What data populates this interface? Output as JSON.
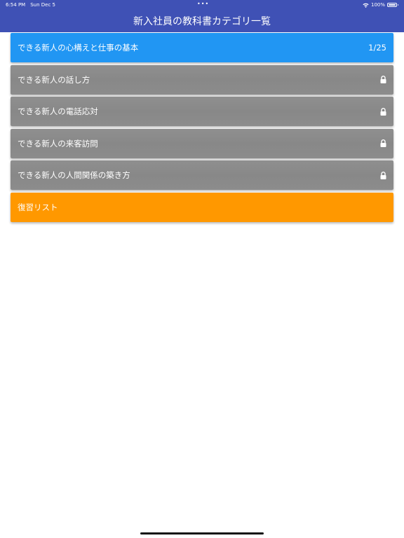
{
  "status_bar": {
    "time": "6:54 PM",
    "date": "Sun Dec 5",
    "dots": "•••",
    "battery": "100%",
    "wifi_icon": "wifi-icon",
    "battery_icon": "battery-icon"
  },
  "header": {
    "title": "新入社員の教科書カテゴリ一覧",
    "background": "#3f51b5"
  },
  "categories": [
    {
      "label": "できる新人の心構えと仕事の基本",
      "progress": "1/25",
      "state": "unlocked",
      "color": "#2196f3"
    },
    {
      "label": "できる新人の話し方",
      "state": "locked",
      "icon": "lock-icon",
      "color": "#8b8b8b"
    },
    {
      "label": "できる新人の電話応対",
      "state": "locked",
      "icon": "lock-icon",
      "color": "#8b8b8b"
    },
    {
      "label": "できる新人の来客訪問",
      "state": "locked",
      "icon": "lock-icon",
      "color": "#8b8b8b"
    },
    {
      "label": "できる新人の人間関係の築き方",
      "state": "locked",
      "icon": "lock-icon",
      "color": "#8b8b8b"
    }
  ],
  "review": {
    "label": "復習リスト",
    "color": "#ff9800"
  }
}
